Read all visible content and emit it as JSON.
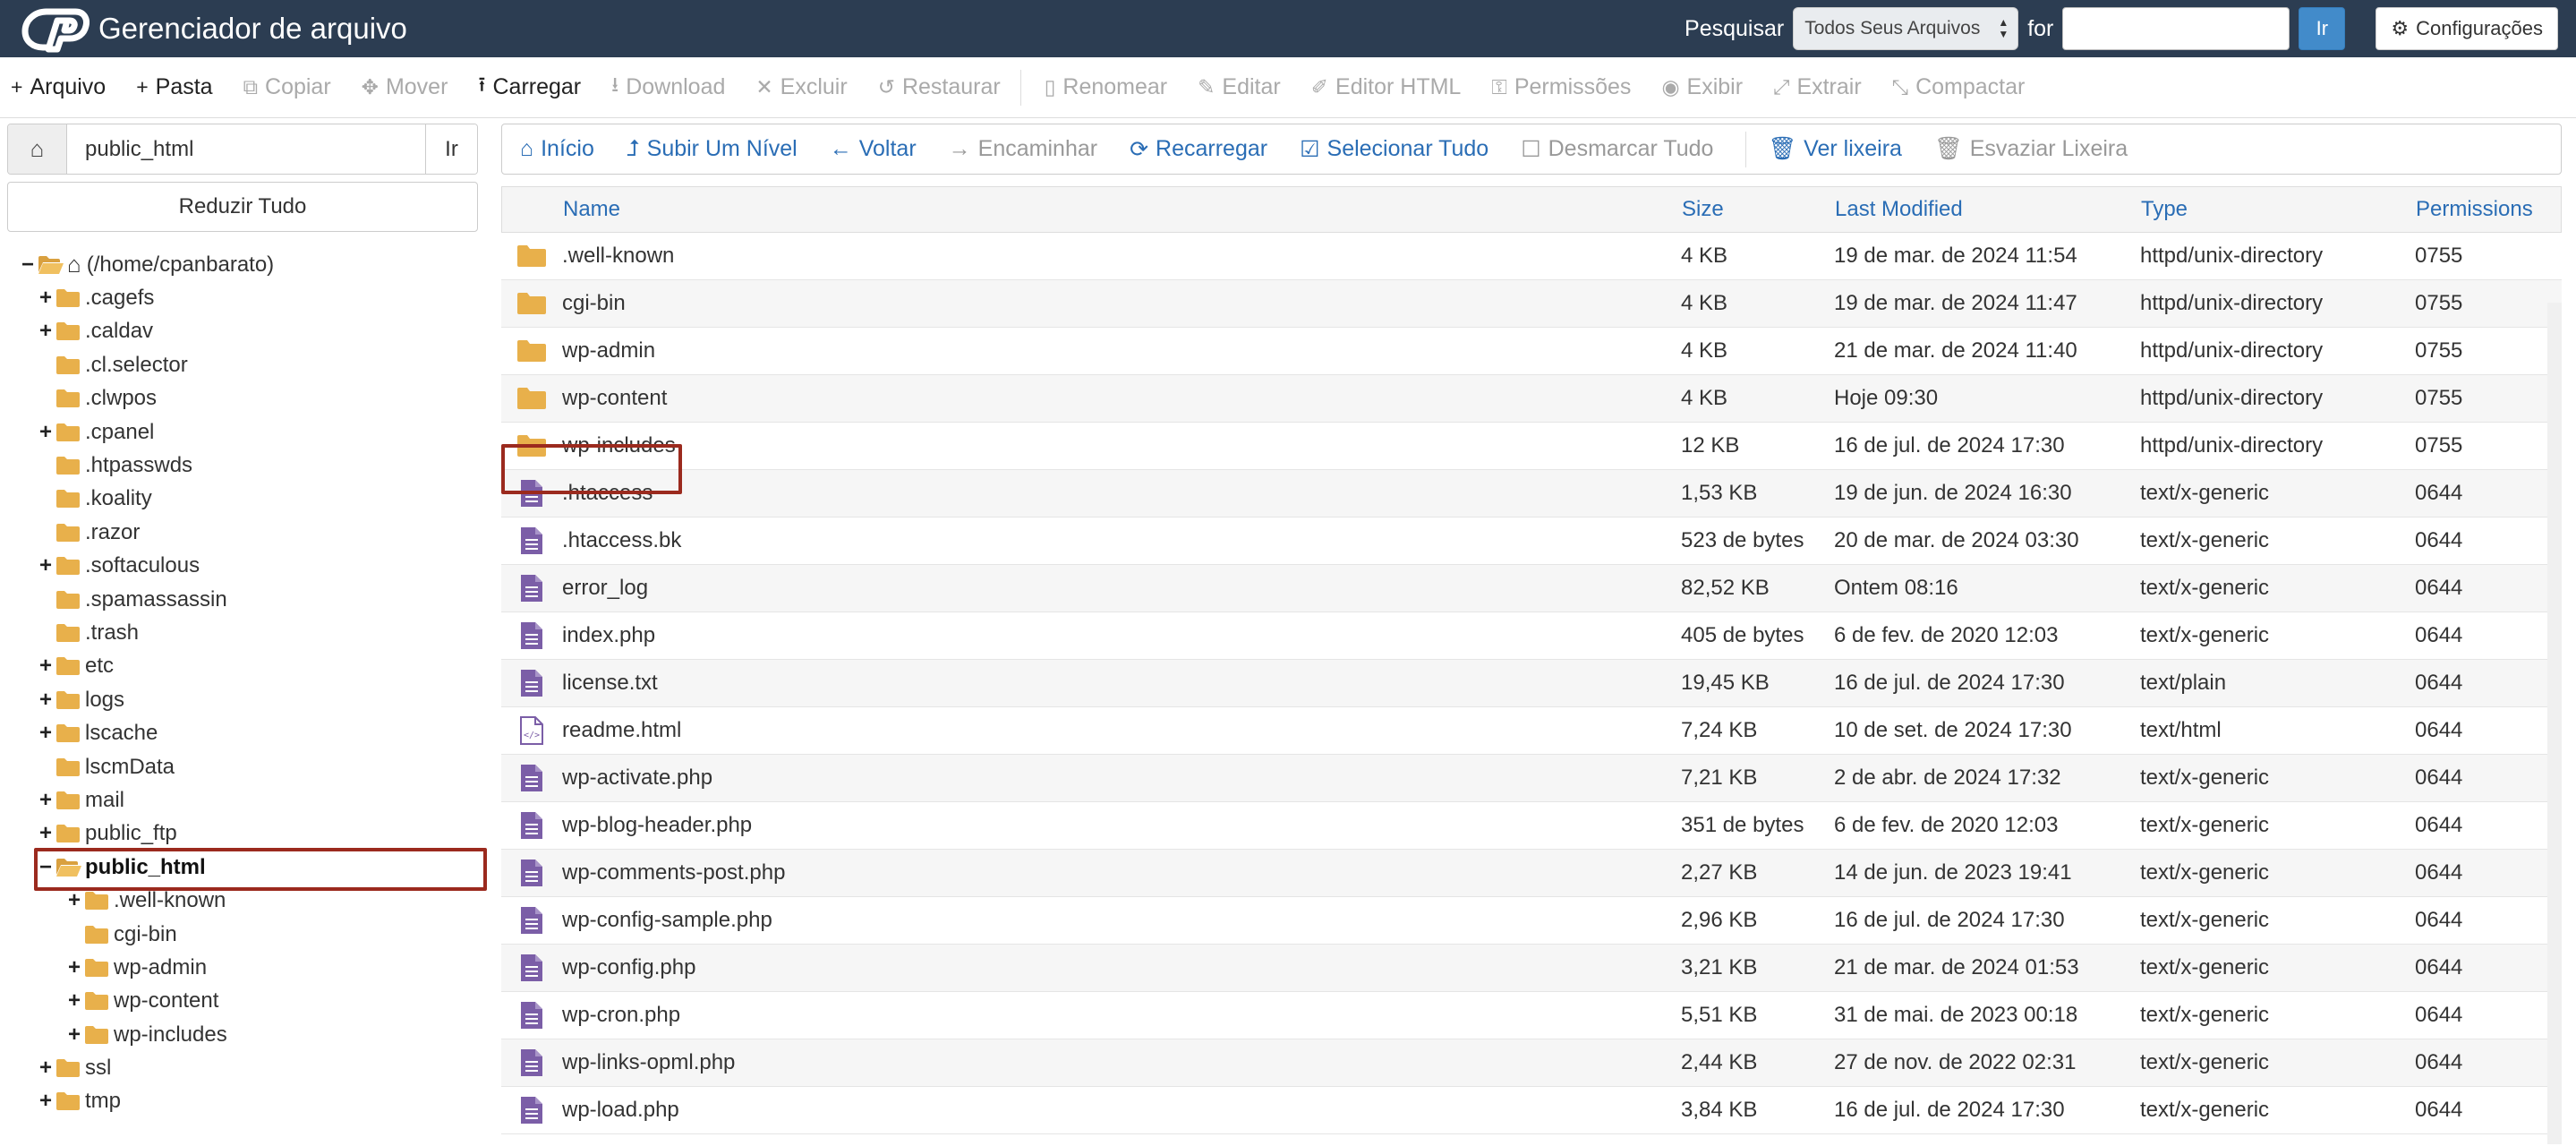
{
  "header": {
    "title": "Gerenciador de arquivo",
    "search_label": "Pesquisar",
    "search_scope": "Todos Seus Arquivos",
    "for_label": "for",
    "search_value": "",
    "go_label": "Ir",
    "settings_label": "Configurações"
  },
  "toolbar": [
    {
      "label": "Arquivo",
      "icon": "plus-icon",
      "glyph": "+",
      "enabled": true
    },
    {
      "label": "Pasta",
      "icon": "plus-icon",
      "glyph": "+",
      "enabled": true
    },
    {
      "label": "Copiar",
      "icon": "copy-icon",
      "glyph": "⧉",
      "enabled": false
    },
    {
      "label": "Mover",
      "icon": "move-icon",
      "glyph": "✥",
      "enabled": false
    },
    {
      "label": "Carregar",
      "icon": "upload-icon",
      "glyph": "⭱",
      "enabled": true
    },
    {
      "label": "Download",
      "icon": "download-icon",
      "glyph": "⭳",
      "enabled": false
    },
    {
      "label": "Excluir",
      "icon": "delete-icon",
      "glyph": "✕",
      "enabled": false
    },
    {
      "label": "Restaurar",
      "icon": "restore-icon",
      "glyph": "↺",
      "enabled": false
    },
    {
      "label": "Renomear",
      "icon": "rename-icon",
      "glyph": "▯",
      "enabled": false
    },
    {
      "label": "Editar",
      "icon": "pencil-icon",
      "glyph": "✎",
      "enabled": false
    },
    {
      "label": "Editor HTML",
      "icon": "html-editor-icon",
      "glyph": "✐",
      "enabled": false
    },
    {
      "label": "Permissões",
      "icon": "key-icon",
      "glyph": "⚿",
      "enabled": false
    },
    {
      "label": "Exibir",
      "icon": "eye-icon",
      "glyph": "◉",
      "enabled": false
    },
    {
      "label": "Extrair",
      "icon": "extract-icon",
      "glyph": "⤢",
      "enabled": false
    },
    {
      "label": "Compactar",
      "icon": "compress-icon",
      "glyph": "⤡",
      "enabled": false
    }
  ],
  "left": {
    "path_value": "public_html",
    "go_label": "Ir",
    "collapse_label": "Reduzir Tudo",
    "tree": [
      {
        "label": "(/home/cpanbarato)",
        "level": 0,
        "toggle": "−",
        "open": true,
        "home": true
      },
      {
        "label": ".cagefs",
        "level": 1,
        "toggle": "+"
      },
      {
        "label": ".caldav",
        "level": 1,
        "toggle": "+"
      },
      {
        "label": ".cl.selector",
        "level": 1,
        "toggle": ""
      },
      {
        "label": ".clwpos",
        "level": 1,
        "toggle": ""
      },
      {
        "label": ".cpanel",
        "level": 1,
        "toggle": "+"
      },
      {
        "label": ".htpasswds",
        "level": 1,
        "toggle": ""
      },
      {
        "label": ".koality",
        "level": 1,
        "toggle": ""
      },
      {
        "label": ".razor",
        "level": 1,
        "toggle": ""
      },
      {
        "label": ".softaculous",
        "level": 1,
        "toggle": "+"
      },
      {
        "label": ".spamassassin",
        "level": 1,
        "toggle": ""
      },
      {
        "label": ".trash",
        "level": 1,
        "toggle": ""
      },
      {
        "label": "etc",
        "level": 1,
        "toggle": "+"
      },
      {
        "label": "logs",
        "level": 1,
        "toggle": "+"
      },
      {
        "label": "lscache",
        "level": 1,
        "toggle": "+"
      },
      {
        "label": "lscmData",
        "level": 1,
        "toggle": ""
      },
      {
        "label": "mail",
        "level": 1,
        "toggle": "+"
      },
      {
        "label": "public_ftp",
        "level": 1,
        "toggle": "+"
      },
      {
        "label": "public_html",
        "level": 1,
        "toggle": "−",
        "open": true,
        "selected": true
      },
      {
        "label": ".well-known",
        "level": 2,
        "toggle": "+"
      },
      {
        "label": "cgi-bin",
        "level": 2,
        "toggle": ""
      },
      {
        "label": "wp-admin",
        "level": 2,
        "toggle": "+"
      },
      {
        "label": "wp-content",
        "level": 2,
        "toggle": "+"
      },
      {
        "label": "wp-includes",
        "level": 2,
        "toggle": "+"
      },
      {
        "label": "ssl",
        "level": 1,
        "toggle": "+"
      },
      {
        "label": "tmp",
        "level": 1,
        "toggle": "+"
      }
    ]
  },
  "subtoolbar": [
    {
      "label": "Início",
      "icon": "home-icon",
      "glyph": "⌂",
      "enabled": true
    },
    {
      "label": "Subir Um Nível",
      "icon": "level-up-icon",
      "glyph": "⮥",
      "enabled": true
    },
    {
      "label": "Voltar",
      "icon": "arrow-left-icon",
      "glyph": "←",
      "enabled": true
    },
    {
      "label": "Encaminhar",
      "icon": "arrow-right-icon",
      "glyph": "→",
      "enabled": false
    },
    {
      "label": "Recarregar",
      "icon": "refresh-icon",
      "glyph": "⟳",
      "enabled": true
    },
    {
      "label": "Selecionar Tudo",
      "icon": "checkbox-checked-icon",
      "glyph": "☑",
      "enabled": true
    },
    {
      "label": "Desmarcar Tudo",
      "icon": "checkbox-empty-icon",
      "glyph": "☐",
      "enabled": false
    },
    {
      "label": "Ver lixeira",
      "icon": "trash-icon",
      "glyph": "🗑",
      "enabled": true
    },
    {
      "label": "Esvaziar Lixeira",
      "icon": "trash-icon",
      "glyph": "🗑",
      "enabled": false
    }
  ],
  "table": {
    "headers": {
      "name": "Name",
      "size": "Size",
      "modified": "Last Modified",
      "type": "Type",
      "perms": "Permissions"
    },
    "rows": [
      {
        "kind": "folder",
        "name": ".well-known",
        "size": "4 KB",
        "modified": "19 de mar. de 2024 11:54",
        "type": "httpd/unix-directory",
        "perms": "0755"
      },
      {
        "kind": "folder",
        "name": "cgi-bin",
        "size": "4 KB",
        "modified": "19 de mar. de 2024 11:47",
        "type": "httpd/unix-directory",
        "perms": "0755"
      },
      {
        "kind": "folder",
        "name": "wp-admin",
        "size": "4 KB",
        "modified": "21 de mar. de 2024 11:40",
        "type": "httpd/unix-directory",
        "perms": "0755"
      },
      {
        "kind": "folder",
        "name": "wp-content",
        "size": "4 KB",
        "modified": "Hoje 09:30",
        "type": "httpd/unix-directory",
        "perms": "0755"
      },
      {
        "kind": "folder",
        "name": "wp-includes",
        "size": "12 KB",
        "modified": "16 de jul. de 2024 17:30",
        "type": "httpd/unix-directory",
        "perms": "0755"
      },
      {
        "kind": "file",
        "name": ".htaccess",
        "size": "1,53 KB",
        "modified": "19 de jun. de 2024 16:30",
        "type": "text/x-generic",
        "perms": "0644"
      },
      {
        "kind": "file",
        "name": ".htaccess.bk",
        "size": "523 de bytes",
        "modified": "20 de mar. de 2024 03:30",
        "type": "text/x-generic",
        "perms": "0644"
      },
      {
        "kind": "file",
        "name": "error_log",
        "size": "82,52 KB",
        "modified": "Ontem 08:16",
        "type": "text/x-generic",
        "perms": "0644"
      },
      {
        "kind": "file",
        "name": "index.php",
        "size": "405 de bytes",
        "modified": "6 de fev. de 2020 12:03",
        "type": "text/x-generic",
        "perms": "0644"
      },
      {
        "kind": "file",
        "name": "license.txt",
        "size": "19,45 KB",
        "modified": "16 de jul. de 2024 17:30",
        "type": "text/plain",
        "perms": "0644"
      },
      {
        "kind": "html",
        "name": "readme.html",
        "size": "7,24 KB",
        "modified": "10 de set. de 2024 17:30",
        "type": "text/html",
        "perms": "0644"
      },
      {
        "kind": "file",
        "name": "wp-activate.php",
        "size": "7,21 KB",
        "modified": "2 de abr. de 2024 17:32",
        "type": "text/x-generic",
        "perms": "0644"
      },
      {
        "kind": "file",
        "name": "wp-blog-header.php",
        "size": "351 de bytes",
        "modified": "6 de fev. de 2020 12:03",
        "type": "text/x-generic",
        "perms": "0644"
      },
      {
        "kind": "file",
        "name": "wp-comments-post.php",
        "size": "2,27 KB",
        "modified": "14 de jun. de 2023 19:41",
        "type": "text/x-generic",
        "perms": "0644"
      },
      {
        "kind": "file",
        "name": "wp-config-sample.php",
        "size": "2,96 KB",
        "modified": "16 de jul. de 2024 17:30",
        "type": "text/x-generic",
        "perms": "0644"
      },
      {
        "kind": "file",
        "name": "wp-config.php",
        "size": "3,21 KB",
        "modified": "21 de mar. de 2024 01:53",
        "type": "text/x-generic",
        "perms": "0644"
      },
      {
        "kind": "file",
        "name": "wp-cron.php",
        "size": "5,51 KB",
        "modified": "31 de mai. de 2023 00:18",
        "type": "text/x-generic",
        "perms": "0644"
      },
      {
        "kind": "file",
        "name": "wp-links-opml.php",
        "size": "2,44 KB",
        "modified": "27 de nov. de 2022 02:31",
        "type": "text/x-generic",
        "perms": "0644"
      },
      {
        "kind": "file",
        "name": "wp-load.php",
        "size": "3,84 KB",
        "modified": "16 de jul. de 2024 17:30",
        "type": "text/x-generic",
        "perms": "0644"
      }
    ]
  },
  "colors": {
    "header_bg": "#2c3d52",
    "link": "#2a6db5",
    "folder": "#e8b04b",
    "file": "#7b5ea7",
    "highlight": "#9b2a1e"
  }
}
